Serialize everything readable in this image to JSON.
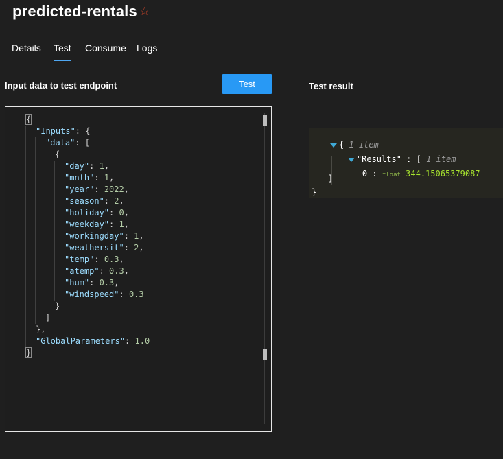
{
  "header": {
    "title": "predicted-rentals",
    "favorite_icon": "star-outline-icon"
  },
  "tabs": [
    {
      "label": "Details",
      "active": false
    },
    {
      "label": "Test",
      "active": true
    },
    {
      "label": "Consume",
      "active": false
    },
    {
      "label": "Logs",
      "active": false
    }
  ],
  "input_panel": {
    "label": "Input data to test endpoint",
    "test_button": "Test",
    "lines": [
      {
        "indent": 0,
        "parts": [
          [
            "p",
            "{"
          ]
        ]
      },
      {
        "indent": 1,
        "parts": [
          [
            "k",
            "\"Inputs\""
          ],
          [
            "p",
            ": {"
          ]
        ]
      },
      {
        "indent": 2,
        "parts": [
          [
            "k",
            "\"data\""
          ],
          [
            "p",
            ": ["
          ]
        ]
      },
      {
        "indent": 3,
        "parts": [
          [
            "p",
            "{"
          ]
        ]
      },
      {
        "indent": 4,
        "parts": [
          [
            "k",
            "\"day\""
          ],
          [
            "p",
            ": "
          ],
          [
            "n",
            "1"
          ],
          [
            "p",
            ","
          ]
        ]
      },
      {
        "indent": 4,
        "parts": [
          [
            "k",
            "\"mnth\""
          ],
          [
            "p",
            ": "
          ],
          [
            "n",
            "1"
          ],
          [
            "p",
            ","
          ]
        ]
      },
      {
        "indent": 4,
        "parts": [
          [
            "k",
            "\"year\""
          ],
          [
            "p",
            ": "
          ],
          [
            "n",
            "2022"
          ],
          [
            "p",
            ","
          ]
        ]
      },
      {
        "indent": 4,
        "parts": [
          [
            "k",
            "\"season\""
          ],
          [
            "p",
            ": "
          ],
          [
            "n",
            "2"
          ],
          [
            "p",
            ","
          ]
        ]
      },
      {
        "indent": 4,
        "parts": [
          [
            "k",
            "\"holiday\""
          ],
          [
            "p",
            ": "
          ],
          [
            "n",
            "0"
          ],
          [
            "p",
            ","
          ]
        ]
      },
      {
        "indent": 4,
        "parts": [
          [
            "k",
            "\"weekday\""
          ],
          [
            "p",
            ": "
          ],
          [
            "n",
            "1"
          ],
          [
            "p",
            ","
          ]
        ]
      },
      {
        "indent": 4,
        "parts": [
          [
            "k",
            "\"workingday\""
          ],
          [
            "p",
            ": "
          ],
          [
            "n",
            "1"
          ],
          [
            "p",
            ","
          ]
        ]
      },
      {
        "indent": 4,
        "parts": [
          [
            "k",
            "\"weathersit\""
          ],
          [
            "p",
            ": "
          ],
          [
            "n",
            "2"
          ],
          [
            "p",
            ","
          ]
        ]
      },
      {
        "indent": 4,
        "parts": [
          [
            "k",
            "\"temp\""
          ],
          [
            "p",
            ": "
          ],
          [
            "n",
            "0.3"
          ],
          [
            "p",
            ","
          ]
        ]
      },
      {
        "indent": 4,
        "parts": [
          [
            "k",
            "\"atemp\""
          ],
          [
            "p",
            ": "
          ],
          [
            "n",
            "0.3"
          ],
          [
            "p",
            ","
          ]
        ]
      },
      {
        "indent": 4,
        "parts": [
          [
            "k",
            "\"hum\""
          ],
          [
            "p",
            ": "
          ],
          [
            "n",
            "0.3"
          ],
          [
            "p",
            ","
          ]
        ]
      },
      {
        "indent": 4,
        "parts": [
          [
            "k",
            "\"windspeed\""
          ],
          [
            "p",
            ": "
          ],
          [
            "n",
            "0.3"
          ]
        ]
      },
      {
        "indent": 3,
        "parts": [
          [
            "p",
            "}"
          ]
        ]
      },
      {
        "indent": 2,
        "parts": [
          [
            "p",
            "]"
          ]
        ]
      },
      {
        "indent": 1,
        "parts": [
          [
            "p",
            "},"
          ]
        ]
      },
      {
        "indent": 1,
        "parts": [
          [
            "k",
            "\"GlobalParameters\""
          ],
          [
            "p",
            ": "
          ],
          [
            "n",
            "1.0"
          ]
        ]
      },
      {
        "indent": 0,
        "parts": [
          [
            "p",
            "}"
          ]
        ]
      }
    ]
  },
  "result_panel": {
    "label": "Test result",
    "root_open": "{",
    "root_meta": "1 item",
    "results_key": "\"Results\"",
    "results_sep": " : [",
    "results_meta": "1 item",
    "item_index": "0",
    "item_sep": " : ",
    "item_type": "float",
    "item_value": "344.15065379087",
    "array_close": "]",
    "root_close": "}"
  }
}
